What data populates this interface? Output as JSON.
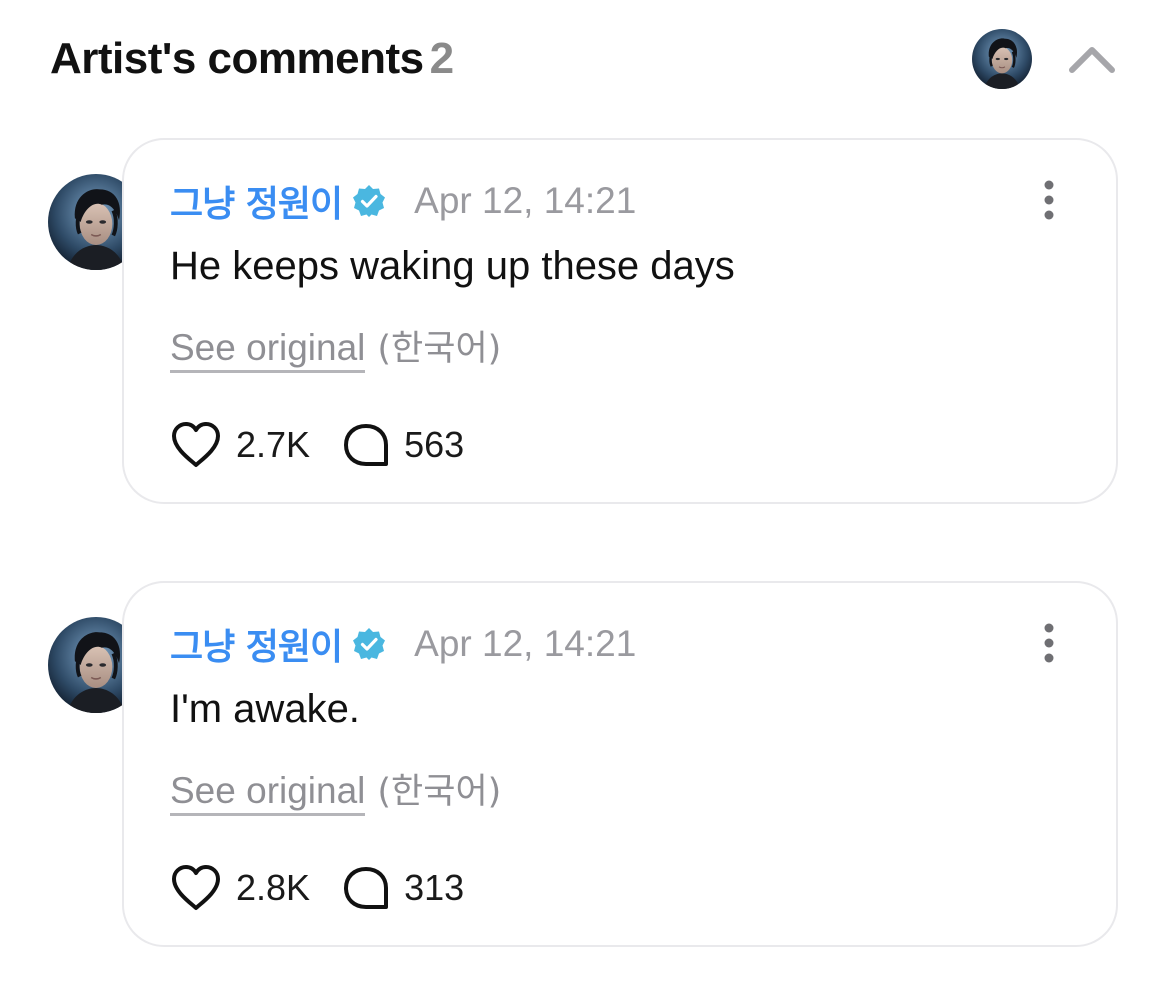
{
  "header": {
    "title": "Artist's comments",
    "count": "2",
    "avatar_icon": "artist-avatar",
    "collapse_icon": "chevron-up-icon"
  },
  "comments": [
    {
      "author": "그냥 정원이",
      "verified_icon": "verified-badge-icon",
      "timestamp": "Apr 12, 14:21",
      "text": "He keeps waking up these days",
      "see_original_label": "See original",
      "language_label": "(한국어)",
      "likes": "2.7K",
      "replies": "563"
    },
    {
      "author": "그냥 정원이",
      "verified_icon": "verified-badge-icon",
      "timestamp": "Apr 12, 14:21",
      "text": "I'm awake.",
      "see_original_label": "See original",
      "language_label": "(한국어)",
      "likes": "2.8K",
      "replies": "313"
    }
  ],
  "colors": {
    "author": "#3a8df2",
    "verified": "#4ab7e0",
    "muted": "#8f8f94",
    "card_border": "#e9e9ec"
  }
}
